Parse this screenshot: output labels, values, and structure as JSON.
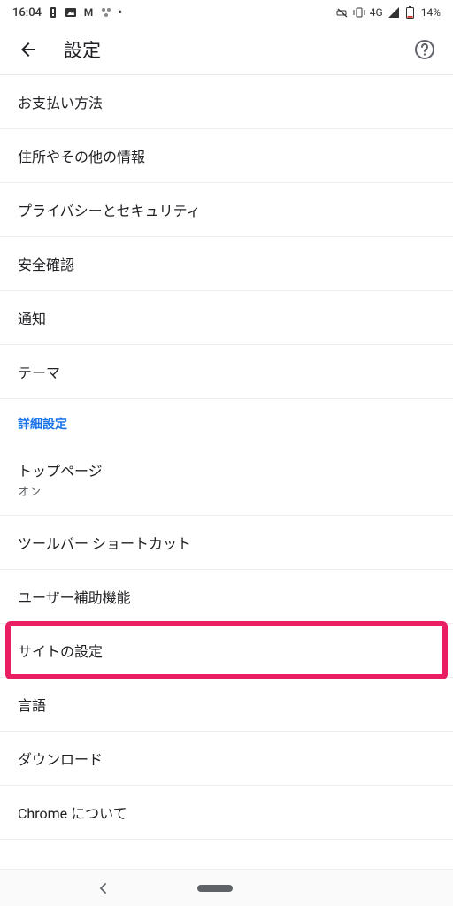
{
  "status": {
    "time": "16:04",
    "network": "4G",
    "battery": "14%"
  },
  "header": {
    "title": "設定"
  },
  "basic": {
    "items": [
      {
        "label": "お支払い方法"
      },
      {
        "label": "住所やその他の情報"
      },
      {
        "label": "プライバシーとセキュリティ"
      },
      {
        "label": "安全確認"
      },
      {
        "label": "通知"
      },
      {
        "label": "テーマ"
      }
    ]
  },
  "advanced": {
    "header": "詳細設定",
    "items": [
      {
        "label": "トップページ",
        "sub": "オン"
      },
      {
        "label": "ツールバー ショートカット"
      },
      {
        "label": "ユーザー補助機能"
      },
      {
        "label": "サイトの設定",
        "highlighted": true
      },
      {
        "label": "言語"
      },
      {
        "label": "ダウンロード"
      },
      {
        "label": "Chrome について"
      }
    ]
  }
}
